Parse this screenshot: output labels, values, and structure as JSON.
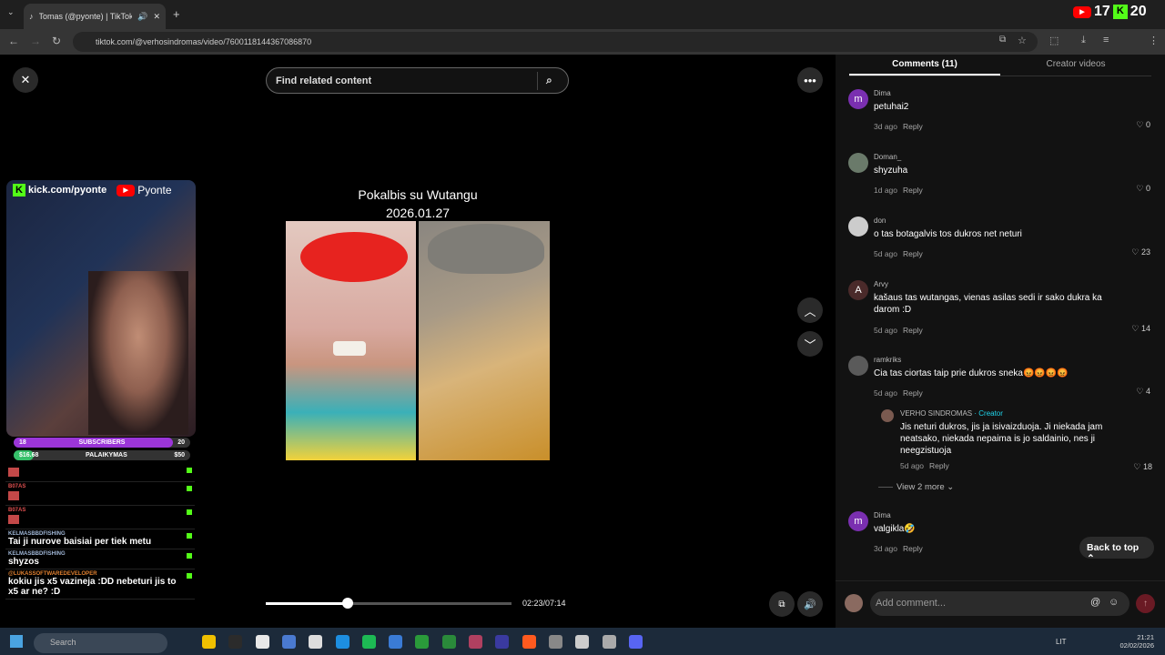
{
  "browser": {
    "tab_title": "Tomas (@pyonte) | TikTok",
    "url": "tiktok.com/@verhosindromas/video/7600118144367086870",
    "overlay_counts": [
      "17",
      "20"
    ]
  },
  "video": {
    "search_placeholder": "Find related content",
    "title_line1": "Pokalbis su Wutangu",
    "title_line2": "2026.01.27",
    "time": "02:23/07:14",
    "progress": 0.335
  },
  "stream": {
    "kick": "kick.com/pyonte",
    "youtube": "Pyonte",
    "sub_left": "18",
    "sub_label": "SUBSCRIBERS",
    "sub_right": "20",
    "sup_left": "$16.68",
    "sup_label": "PALAIKYMAS",
    "sup_right": "$50",
    "sub_fill": 0.9,
    "sup_fill": 0.05
  },
  "chat": [
    {
      "user": "",
      "text": "",
      "emote": true
    },
    {
      "user": "B07AS",
      "text": "",
      "emote": true,
      "cls": "red"
    },
    {
      "user": "B07AS",
      "text": "",
      "emote": true,
      "cls": "red"
    },
    {
      "user": "KELMASBBDFISHING",
      "text": "Tai ji nurove baisiai per tiek metu"
    },
    {
      "user": "KELMASBBDFISHING",
      "text": "shyzos"
    },
    {
      "user": "@LUKASSOFTWAREDEVELOPER",
      "text": "kokiu jis x5 vazineja :DD nebeturi jis to x5 ar ne? :D",
      "cls": "org"
    }
  ],
  "panel": {
    "tab_comments": "Comments (11)",
    "tab_creator": "Creator videos",
    "back_to_top": "Back to top",
    "add_comment": "Add comment...",
    "view_more": "View 2 more"
  },
  "comments": [
    {
      "name": "Dima",
      "avatar": "m",
      "color": "#7a2fb0",
      "text": "petuhai2",
      "time": "3d ago",
      "likes": "0"
    },
    {
      "name": "Doman_",
      "avatar": "",
      "color": "#6a7a6a",
      "text": "shyzuha",
      "time": "1d ago",
      "likes": "0"
    },
    {
      "name": "don",
      "avatar": "",
      "color": "#ccc",
      "text": "o tas botagalvis tos dukros net neturi",
      "time": "5d ago",
      "likes": "23"
    },
    {
      "name": "Arvy",
      "avatar": "A",
      "color": "#4a2a2a",
      "text": "kašaus tas wutangas, vienas asilas sedi ir sako dukra ka darom :D",
      "time": "5d ago",
      "likes": "14"
    },
    {
      "name": "ramkriks",
      "avatar": "",
      "color": "#5a5a5a",
      "text": "Cia tas ciortas taip prie dukros sneka😡😡😡😡",
      "time": "5d ago",
      "likes": "4"
    },
    {
      "name": "Dima",
      "avatar": "m",
      "color": "#7a2fb0",
      "text": "valgikla🤣",
      "time": "3d ago",
      "likes": ""
    }
  ],
  "reply": {
    "name": "VERHO SINDROMAS",
    "badge": "· Creator",
    "text": "Jis neturi dukros, jis ja isivaizduoja. Ji niekada jam neatsako, niekada nepaima is jo saldainio, nes ji neegzistuoja",
    "time": "5d ago",
    "likes": "18"
  },
  "ui": {
    "reply_label": "Reply",
    "taskbar_search": "Search",
    "lang": "LIT",
    "clock_time": "21:21",
    "clock_date": "02/02/2026"
  }
}
